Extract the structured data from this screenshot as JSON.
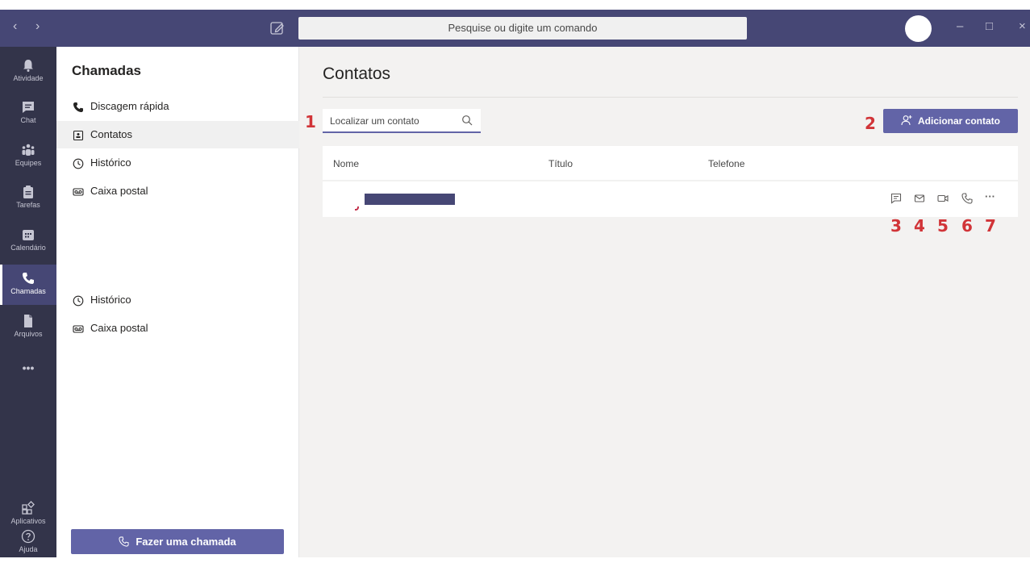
{
  "titlebar": {
    "back_glyph": "‹",
    "forward_glyph": "›",
    "search_placeholder": "Pesquise ou digite um comando",
    "minimize_glyph": "–",
    "maximize_glyph": "□",
    "close_glyph": "×"
  },
  "rail": {
    "items": [
      {
        "label": "Atividade",
        "icon": "bell-icon"
      },
      {
        "label": "Chat",
        "icon": "chat-icon"
      },
      {
        "label": "Equipes",
        "icon": "teams-icon"
      },
      {
        "label": "Tarefas",
        "icon": "tasks-icon"
      },
      {
        "label": "Calendário",
        "icon": "calendar-icon"
      },
      {
        "label": "Chamadas",
        "icon": "phone-icon",
        "active": true
      },
      {
        "label": "Arquivos",
        "icon": "files-icon"
      }
    ],
    "more": "•••",
    "bottom": [
      {
        "label": "Aplicativos",
        "icon": "apps-icon"
      },
      {
        "label": "Ajuda",
        "icon": "help-icon"
      }
    ]
  },
  "panel": {
    "title": "Chamadas",
    "items_top": [
      {
        "label": "Discagem rápida",
        "icon": "speed-dial-icon"
      },
      {
        "label": "Contatos",
        "icon": "contacts-icon",
        "active": true
      },
      {
        "label": "Histórico",
        "icon": "history-icon"
      },
      {
        "label": "Caixa postal",
        "icon": "voicemail-icon"
      }
    ],
    "items_bottom": [
      {
        "label": "Histórico",
        "icon": "history-icon"
      },
      {
        "label": "Caixa postal",
        "icon": "voicemail-icon"
      }
    ],
    "call_button": "Fazer uma chamada"
  },
  "main": {
    "title": "Contatos",
    "find_placeholder": "Localizar um contato",
    "add_contact": "Adicionar contato",
    "columns": [
      "Nome",
      "Título",
      "Telefone"
    ],
    "row_actions": [
      "chat-icon",
      "email-icon",
      "video-icon",
      "call-icon",
      "more-icon"
    ],
    "more_glyph": "···"
  },
  "annotations": [
    "1",
    "2",
    "3",
    "4",
    "5",
    "6",
    "7"
  ],
  "colors": {
    "titlebar": "#464775",
    "rail": "#33344a",
    "accent": "#6264a7",
    "annotation": "#d13438"
  }
}
